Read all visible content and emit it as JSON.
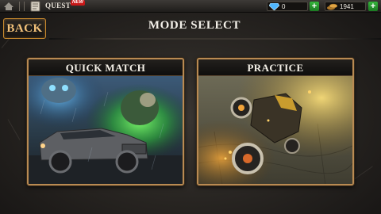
{
  "topbar": {
    "quest_label": "QUEST",
    "new_badge": "NEW",
    "gems_value": "0",
    "coins_value": "1941",
    "plus_symbol": "+"
  },
  "header": {
    "back_label": "BACK",
    "title": "MODE SELECT"
  },
  "modes": [
    {
      "label": "QUICK MATCH"
    },
    {
      "label": "PRACTICE"
    }
  ],
  "colors": {
    "accent": "#c98a2e",
    "card_border": "#b98a52",
    "plus_green": "#34b53a",
    "new_red": "#c81818"
  }
}
